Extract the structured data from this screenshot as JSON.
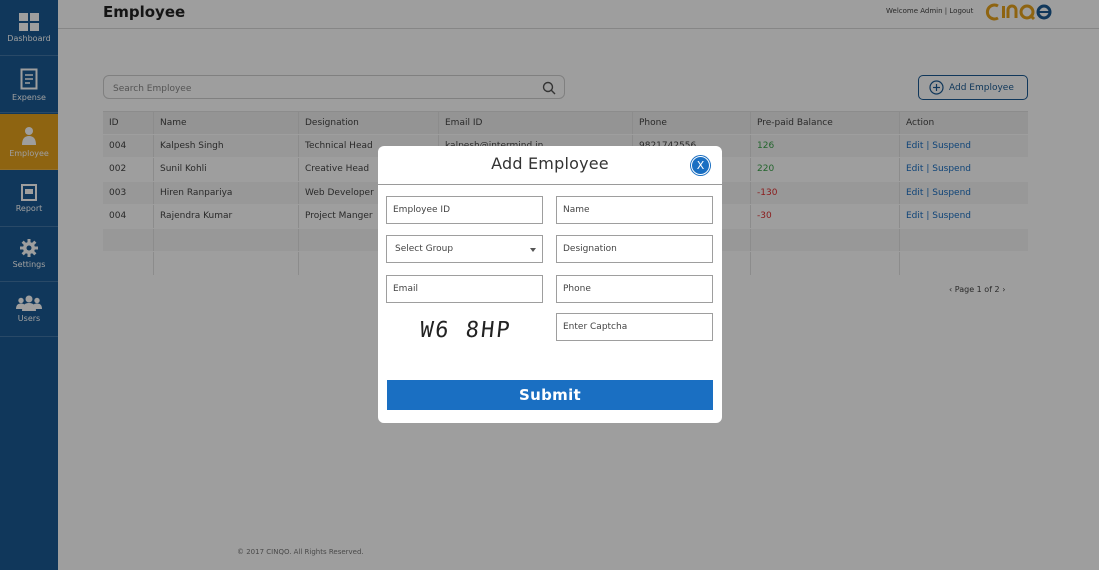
{
  "app": {
    "logo_text": "CINQO"
  },
  "sidebar": {
    "items": [
      {
        "label": "Dashboard",
        "icon": "dashboard-icon"
      },
      {
        "label": "Expense",
        "icon": "receipt-icon"
      },
      {
        "label": "Employee",
        "icon": "person-icon",
        "active": true
      },
      {
        "label": "Report",
        "icon": "report-icon"
      },
      {
        "label": "Settings",
        "icon": "gear-icon"
      },
      {
        "label": "Users",
        "icon": "users-icon"
      }
    ]
  },
  "header": {
    "title": "Employee",
    "welcome": "Welcome Admin",
    "separator": "|",
    "logout": "Logout"
  },
  "toolbar": {
    "search_placeholder": "Search Employee",
    "add_label": "Add Employee"
  },
  "table": {
    "columns": [
      "ID",
      "Name",
      "Designation",
      "Email ID",
      "Phone",
      "Pre-paid Balance",
      "Action"
    ],
    "rows": [
      {
        "id": "004",
        "name": "Kalpesh Singh",
        "designation": "Technical Head",
        "email": "kalpesh@intermind.in",
        "phone": "9821742556",
        "balance": "126",
        "edit": "Edit",
        "sep": "|",
        "suspend": "Suspend"
      },
      {
        "id": "002",
        "name": "Sunil Kohli",
        "designation": "Creative Head",
        "email": "",
        "phone": "",
        "balance": "220",
        "edit": "Edit",
        "sep": "|",
        "suspend": "Suspend"
      },
      {
        "id": "003",
        "name": "Hiren Ranpariya",
        "designation": "Web Developer",
        "email": "",
        "phone": "",
        "balance": "-130",
        "edit": "Edit",
        "sep": "|",
        "suspend": "Suspend"
      },
      {
        "id": "004",
        "name": "Rajendra Kumar",
        "designation": "Project Manger",
        "email": "",
        "phone": "",
        "balance": "-30",
        "edit": "Edit",
        "sep": "|",
        "suspend": "Suspend"
      }
    ],
    "pager": "Page 1 of 2"
  },
  "footer": {
    "text": "© 2017 CINQO. All Rights Reserved."
  },
  "modal": {
    "title": "Add Employee",
    "close": "X",
    "fields": {
      "employee_id": "Employee ID",
      "name": "Name",
      "group": "Select Group",
      "designation": "Designation",
      "email": "Email",
      "phone": "Phone",
      "captcha_input": "Enter Captcha"
    },
    "captcha_text": "W6 8HP",
    "submit": "Submit"
  },
  "colors": {
    "sidebar": "#1a5a93",
    "active": "#e6a21c",
    "primary": "#1a6fc2",
    "positive": "#3aa34a",
    "negative": "#e03030"
  }
}
